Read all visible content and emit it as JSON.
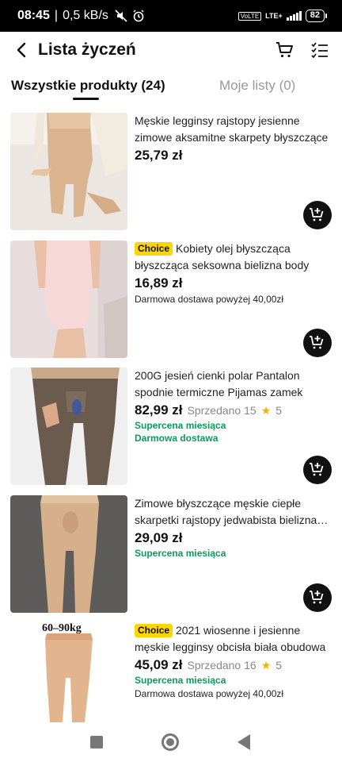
{
  "status_bar": {
    "time": "08:45",
    "speed": "0,5 kB/s",
    "volte": "VoLTE",
    "network": "LTE+",
    "battery": "82"
  },
  "header": {
    "title": "Lista życzeń",
    "icons": [
      "back-arrow-icon",
      "cart-icon",
      "checklist-icon"
    ]
  },
  "tabs": [
    {
      "label": "Wszystkie produkty (24)",
      "active": true
    },
    {
      "label": "Moje listy (0)",
      "active": false
    }
  ],
  "products": [
    {
      "title": "Męskie legginsy rajstopy jesienne zimowe aksamitne skarpety błyszczące U wypuk…",
      "choice": false,
      "price": "25,79 zł",
      "sold": "",
      "rating": "",
      "tag": "",
      "tag2": "",
      "shipping": ""
    },
    {
      "title": "Kobiety olej błyszcząca błyszcząca seksowna bielizna body przepuszczalno…",
      "choice": true,
      "price": "16,89 zł",
      "sold": "",
      "rating": "",
      "tag": "",
      "tag2": "",
      "shipping": "Darmowa dostawa powyżej 40,00zł"
    },
    {
      "title": "200G jesień cienki polar Pantalon spodnie termiczne Pijamas zamek otwarte krocz…",
      "choice": false,
      "price": "82,99 zł",
      "sold": "Sprzedano 15",
      "rating": "5",
      "tag": "Supercena miesiąca",
      "tag2": "Darmowa dostawa",
      "shipping": ""
    },
    {
      "title": "Zimowe błyszczące męskie ciepłe skarpetki rajstopy jedwabista bielizna…",
      "choice": false,
      "price": "29,09 zł",
      "sold": "",
      "rating": "",
      "tag": "Supercena miesiąca",
      "tag2": "",
      "shipping": ""
    },
    {
      "title": "2021 wiosenne i jesienne męskie legginsy obcisła biała obudowa ciepłe…",
      "choice": true,
      "price": "45,09 zł",
      "sold": "Sprzedano 16",
      "rating": "5",
      "tag": "Supercena miesiąca",
      "tag2": "",
      "shipping": "Darmowa dostawa powyżej 40,00zł"
    }
  ],
  "choice_label": "Choice",
  "thumb5_overlay": "60–90kg",
  "colors": {
    "accent_green": "#0a9b5c",
    "choice_yellow": "#fbd600",
    "star": "#f5b400"
  }
}
